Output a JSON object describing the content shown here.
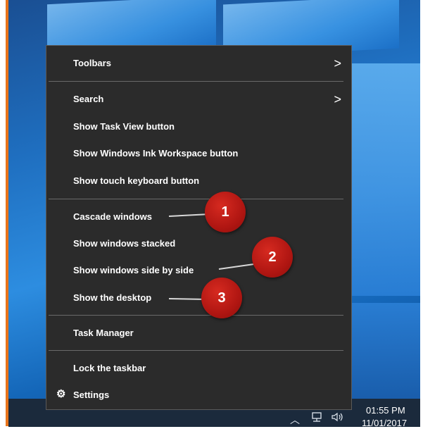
{
  "menu": {
    "items": [
      {
        "label": "Toolbars",
        "has_submenu": true
      },
      {
        "label": "Search",
        "has_submenu": true
      },
      {
        "label": "Show Task View button",
        "has_submenu": false
      },
      {
        "label": "Show Windows Ink Workspace button",
        "has_submenu": false
      },
      {
        "label": "Show touch keyboard button",
        "has_submenu": false
      },
      {
        "label": "Cascade windows",
        "has_submenu": false
      },
      {
        "label": "Show windows stacked",
        "has_submenu": false
      },
      {
        "label": "Show windows side by side",
        "has_submenu": false
      },
      {
        "label": "Show the desktop",
        "has_submenu": false
      },
      {
        "label": "Task Manager",
        "has_submenu": false
      },
      {
        "label": "Lock the taskbar",
        "has_submenu": false
      },
      {
        "label": "Settings",
        "has_submenu": false,
        "icon": "gear-icon"
      }
    ],
    "submenu_glyph": ">"
  },
  "callouts": [
    {
      "number": "1",
      "target": "Cascade windows"
    },
    {
      "number": "2",
      "target": "Show windows side by side"
    },
    {
      "number": "3",
      "target": "Show the desktop"
    }
  ],
  "taskbar": {
    "time": "01:55 PM",
    "date": "11/01/2017",
    "tray_icons": [
      "chevron-up-icon",
      "network-icon",
      "volume-icon"
    ]
  },
  "colors": {
    "menu_bg": "#2b2b2b",
    "callout": "#b01612",
    "frame": "#e8741a"
  }
}
